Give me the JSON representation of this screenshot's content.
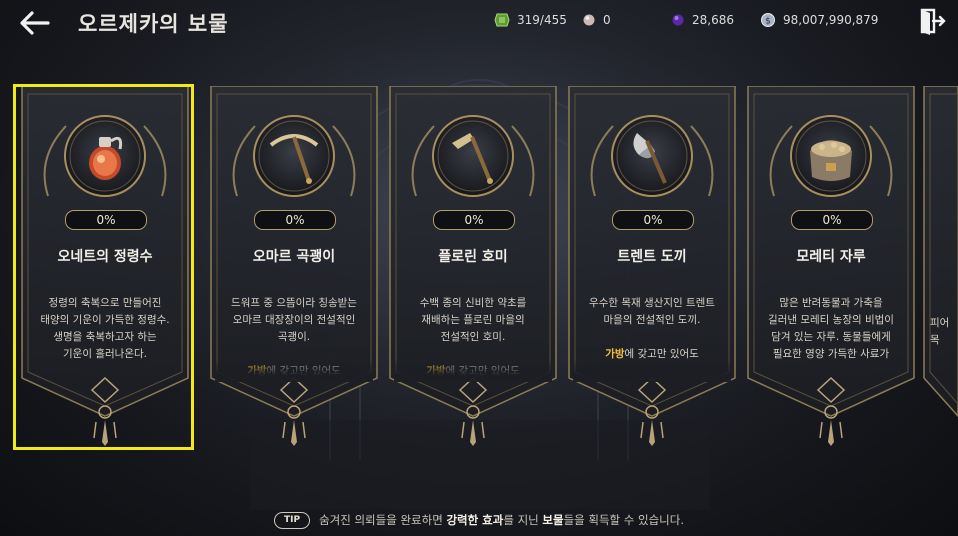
{
  "header": {
    "title": "오르제카의 보물",
    "back_icon": "arrow-left-icon",
    "exit_icon": "exit-door-icon"
  },
  "currencies": [
    {
      "icon": "green-gem-icon",
      "value": "319/455",
      "color": "#6fae3c"
    },
    {
      "icon": "pearl-icon",
      "value": "0",
      "color": "#d9c7c2"
    },
    {
      "icon": "purple-orb-icon",
      "value": "28,686",
      "color": "#7b3fd0"
    },
    {
      "icon": "silver-coin-icon",
      "value": "98,007,990,879",
      "color": "#cfd6e6"
    }
  ],
  "cards": [
    {
      "name": "오네트의 정령수",
      "progress": "0%",
      "icon": "spirit-potion-icon",
      "selected": true,
      "desc": [
        "정령의 축복으로 만들어진",
        "태양의 기운이 가득한 정령수.",
        "생명을 축복하고자 하는",
        "기운이 흘러나온다."
      ],
      "desc_tail": ""
    },
    {
      "name": "오마르 곡괭이",
      "progress": "0%",
      "icon": "pickaxe-icon",
      "selected": false,
      "desc": [
        "드워프 중 으뜸이라 칭송받는",
        "오마르 대장장이의 전설적인",
        "곡괭이."
      ],
      "desc_tail": "가방에 갖고만 있어도"
    },
    {
      "name": "플로린 호미",
      "progress": "0%",
      "icon": "hoe-icon",
      "selected": false,
      "desc": [
        "수백 종의 신비한 약초를",
        "재배하는 플로린 마을의",
        "전설적인 호미."
      ],
      "desc_tail": "가방에 갖고만 있어도"
    },
    {
      "name": "트렌트 도끼",
      "progress": "0%",
      "icon": "axe-icon",
      "selected": false,
      "desc": [
        "우수한 목재 생산지인 트렌트",
        "마을의 전설적인 도끼."
      ],
      "desc_tail": "가방에 갖고만 있어도"
    },
    {
      "name": "모레티 자루",
      "progress": "0%",
      "icon": "food-sack-icon",
      "selected": false,
      "desc": [
        "많은 반려동물과 가축을",
        "길러낸 모레티 농장의 비법이",
        "담겨 있는 자루. 동물들에게",
        "필요한 영양 가득한 사료가"
      ],
      "desc_tail": ""
    }
  ],
  "partial_card": {
    "name": "",
    "desc": [
      "피어",
      "목"
    ]
  },
  "tip": {
    "badge": "TIP",
    "text_1": "숨겨진 의뢰들을 완료하면",
    "strong_1": "강력한 효과",
    "text_2": "를 지닌",
    "strong_2": "보물",
    "text_3": "들을 획득할 수 있습니다."
  }
}
